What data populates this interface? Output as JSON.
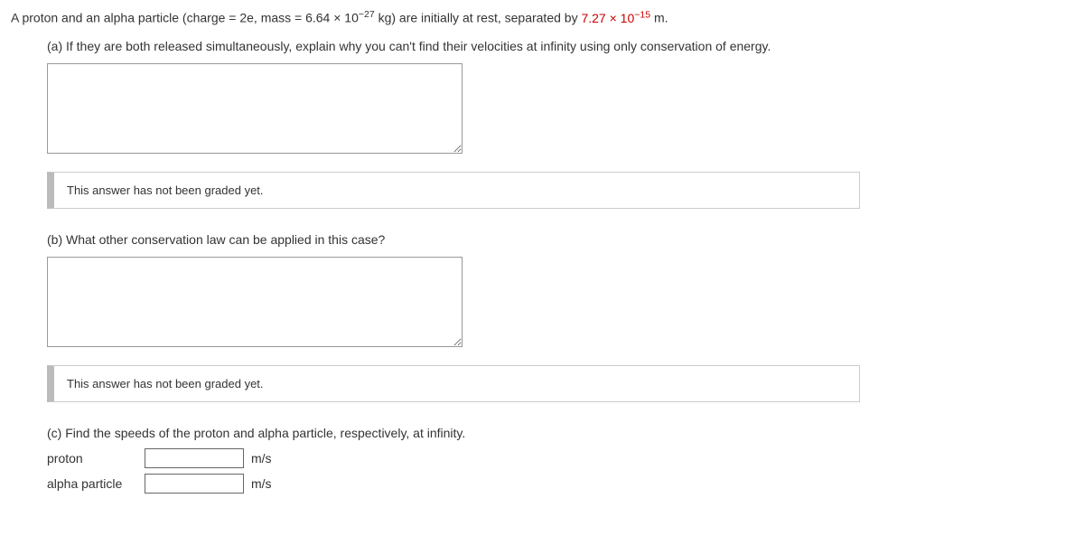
{
  "problem": {
    "intro_before": "A proton and an alpha particle (charge = 2e, mass = 6.64 × 10",
    "intro_sup1": "−27",
    "intro_mid": " kg) are initially at rest, separated by ",
    "red_before": "7.27 × 10",
    "red_sup": "−15",
    "intro_after": " m."
  },
  "parts": {
    "a": {
      "prompt": "(a) If they are both released simultaneously, explain why you can't find their velocities at infinity using only conservation of energy.",
      "status": "This answer has not been graded yet."
    },
    "b": {
      "prompt": "(b) What other conservation law can be applied in this case?",
      "status": "This answer has not been graded yet."
    },
    "c": {
      "prompt": "(c) Find the speeds of the proton and alpha particle, respectively, at infinity.",
      "rows": [
        {
          "label": "proton",
          "unit": "m/s"
        },
        {
          "label": "alpha particle",
          "unit": "m/s"
        }
      ]
    }
  }
}
